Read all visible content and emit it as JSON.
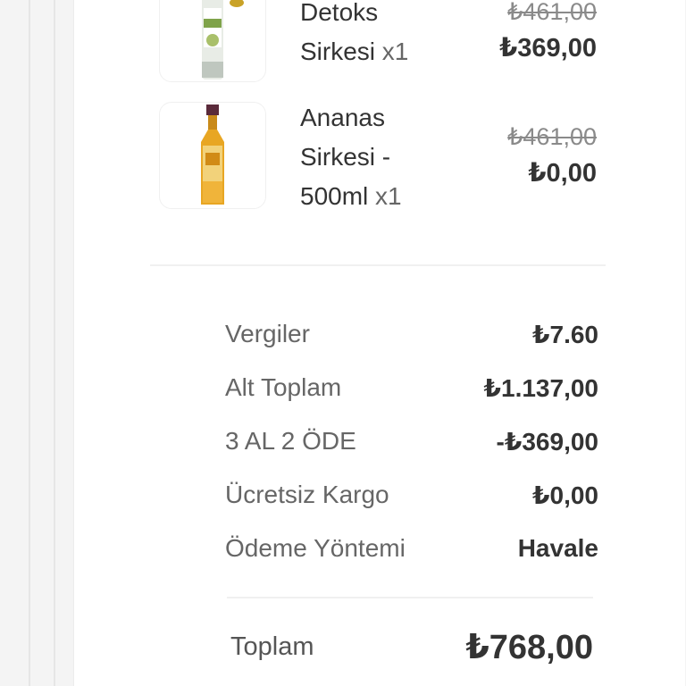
{
  "items": [
    {
      "name_line1": "Detoks",
      "name_line2": "Sirkesi",
      "qty": "x1",
      "old_price": "₺461,00",
      "new_price": "₺369,00"
    },
    {
      "name_line1": "Ananas",
      "name_line2": "Sirkesi -",
      "name_line3": "500ml",
      "qty": "x1",
      "old_price": "₺461,00",
      "new_price": "₺0,00"
    }
  ],
  "summary": [
    {
      "label": "Vergiler",
      "value": "₺7.60"
    },
    {
      "label": "Alt Toplam",
      "value": "₺1.137,00"
    },
    {
      "label": "3 AL 2 ÖDE",
      "value": "-₺369,00"
    },
    {
      "label": "Ücretsiz Kargo",
      "value": "₺0,00"
    },
    {
      "label": "Ödeme Yöntemi",
      "value": "Havale"
    }
  ],
  "total": {
    "label": "Toplam",
    "value": "₺768,00"
  },
  "colors": {
    "text": "#333333",
    "muted": "#666666",
    "strike": "#8a8a8a",
    "divider": "#f0f0f0"
  }
}
